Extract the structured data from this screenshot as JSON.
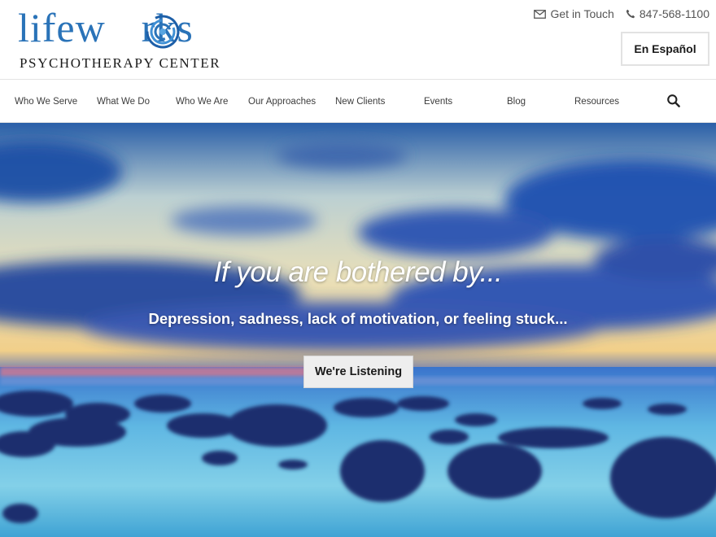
{
  "brand": {
    "word_start": "lifew",
    "word_end": "rks",
    "tagline": "PSYCHOTHERAPY CENTER",
    "color": "#2a73b8"
  },
  "contact": {
    "get_in_touch": "Get in Touch",
    "phone": "847-568-1100",
    "icons": [
      "envelope-icon",
      "phone-icon"
    ]
  },
  "language_button": "En Español",
  "nav": {
    "items": [
      "Who We Serve",
      "What We Do",
      "Who We Are",
      "Our Approaches",
      "New Clients",
      "Events",
      "Blog",
      "Resources"
    ],
    "search_icon": "search-icon"
  },
  "hero": {
    "headline": "If you are bothered by...",
    "subline": "Depression, sadness, lack of motivation, or feeling stuck...",
    "cta": "We're Listening"
  }
}
